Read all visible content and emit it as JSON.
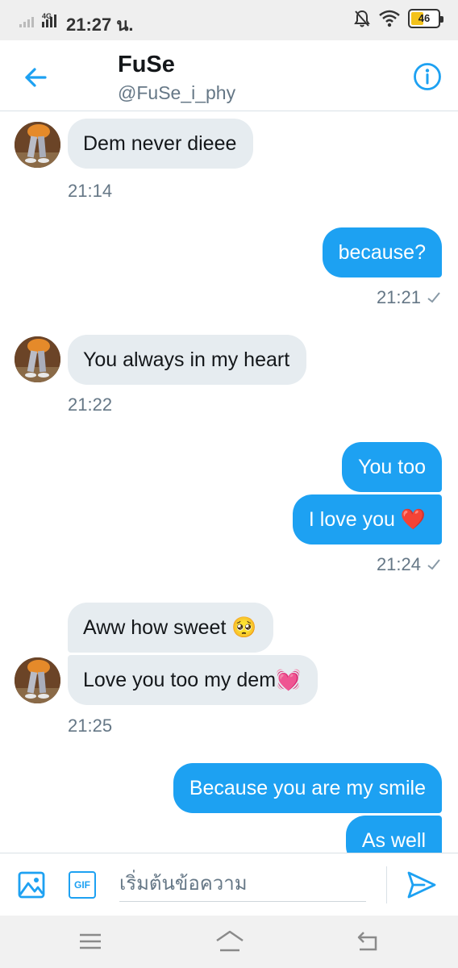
{
  "status_bar": {
    "network": "4G",
    "time": "21:27 น.",
    "battery": "46",
    "battery_level": 0.46
  },
  "header": {
    "name": "FuSe",
    "handle": "@FuSe_i_phy"
  },
  "messages": [
    {
      "text": "Dem never dieee"
    },
    {
      "text": "because?"
    },
    {
      "text": "You always in my heart"
    },
    {
      "text": "You too"
    },
    {
      "text": "I love you ❤️"
    },
    {
      "text": "Aww how sweet 🥺"
    },
    {
      "text": "Love you too my dem💓"
    },
    {
      "text": "Because you are my smile"
    },
    {
      "text": "As well"
    }
  ],
  "timestamps": [
    "21:14",
    "21:21",
    "21:22",
    "21:24",
    "21:25"
  ],
  "composer": {
    "gif_label": "GIF",
    "placeholder": "เริ่มต้นข้อความ"
  },
  "icons": {
    "back": "arrow-left-icon",
    "info": "info-icon",
    "media": "image-icon",
    "send": "send-icon",
    "read": "checkmark-icon",
    "nav": [
      "menu-icon",
      "home-icon",
      "back-icon"
    ]
  },
  "colors": {
    "accent": "#1da1f2",
    "incoming_bubble": "#e6ecf0",
    "timestamp": "#657786",
    "text": "#14171a"
  }
}
